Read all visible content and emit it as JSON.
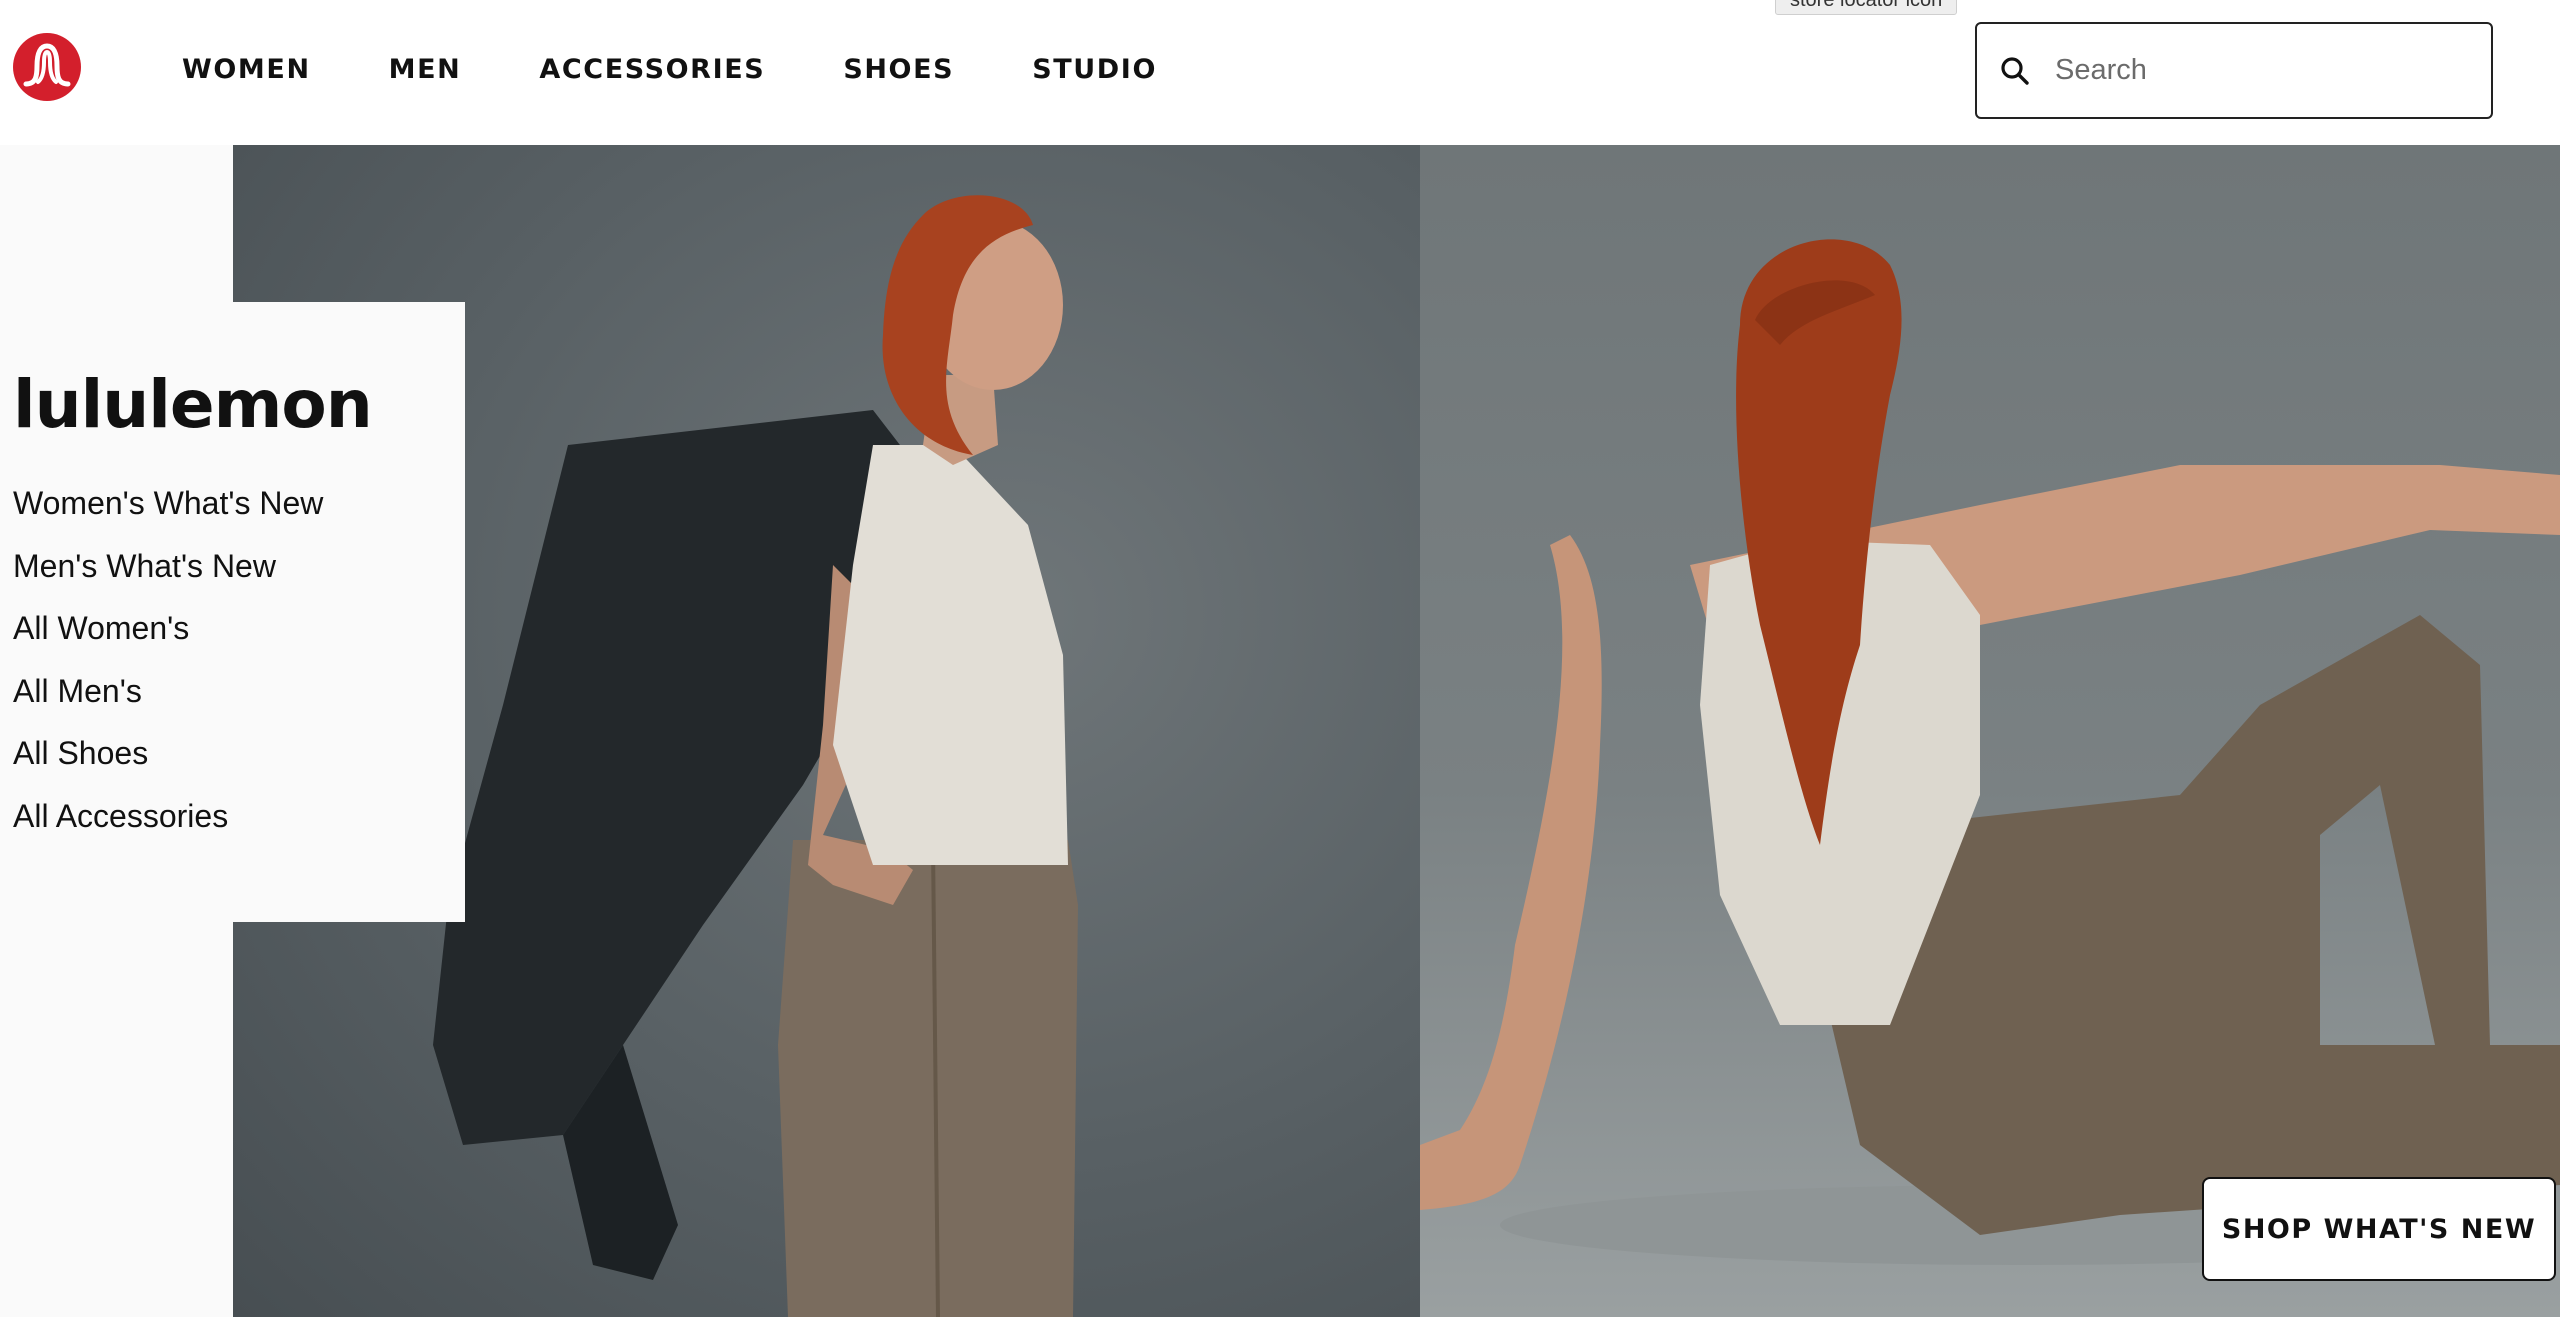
{
  "header": {
    "logo_icon": "lululemon-logo-icon",
    "brand_color": "#d31f2c",
    "nav": [
      {
        "label": "WOMEN"
      },
      {
        "label": "MEN"
      },
      {
        "label": "ACCESSORIES"
      },
      {
        "label": "SHOES"
      },
      {
        "label": "STUDIO"
      }
    ],
    "tooltip": "store locator icon",
    "search": {
      "icon": "search-icon",
      "placeholder": "Search",
      "value": ""
    }
  },
  "hero": {
    "brand_title": "lululemon",
    "menu": [
      {
        "label": "Women's What's New"
      },
      {
        "label": "Men's What's New"
      },
      {
        "label": "All Women's"
      },
      {
        "label": "All Men's"
      },
      {
        "label": "All Shoes"
      },
      {
        "label": "All Accessories"
      }
    ],
    "cta_label": "SHOP WHAT'S NEW"
  }
}
